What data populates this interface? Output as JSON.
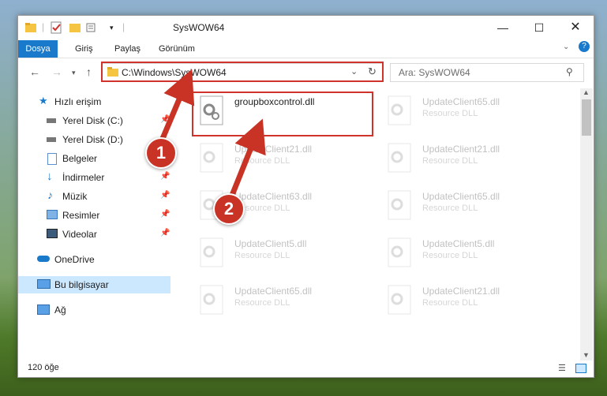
{
  "window": {
    "title": "SysWOW64"
  },
  "ribbon": {
    "tabs": [
      "Dosya",
      "Giriş",
      "Paylaş",
      "Görünüm"
    ]
  },
  "address": {
    "path": "C:\\Windows\\SysWOW64",
    "search_placeholder": "Ara: SysWOW64"
  },
  "sidebar": {
    "items": [
      {
        "label": "Hızlı erişim",
        "icon": "star-icon"
      },
      {
        "label": "Yerel Disk (C:)",
        "icon": "drive-icon"
      },
      {
        "label": "Yerel Disk (D:)",
        "icon": "drive-icon"
      },
      {
        "label": "Belgeler",
        "icon": "documents-icon"
      },
      {
        "label": "İndirmeler",
        "icon": "download-icon"
      },
      {
        "label": "Müzik",
        "icon": "music-icon"
      },
      {
        "label": "Resimler",
        "icon": "pictures-icon"
      },
      {
        "label": "Videolar",
        "icon": "videos-icon"
      },
      {
        "label": "OneDrive",
        "icon": "cloud-icon"
      },
      {
        "label": "Bu bilgisayar",
        "icon": "computer-icon"
      },
      {
        "label": "Ağ",
        "icon": "network-icon"
      }
    ]
  },
  "files": [
    {
      "name": "groupboxcontrol.dll",
      "type": ""
    },
    {
      "name": "UpdateClient65.dll",
      "type": "Resource DLL"
    },
    {
      "name": "UpdateClient21.dll",
      "type": "Resource DLL"
    },
    {
      "name": "UpdateClient21.dll",
      "type": "Resource DLL"
    },
    {
      "name": "UpdateClient63.dll",
      "type": "Resource DLL"
    },
    {
      "name": "UpdateClient65.dll",
      "type": "Resource DLL"
    },
    {
      "name": "UpdateClient5.dll",
      "type": "Resource DLL"
    },
    {
      "name": "UpdateClient5.dll",
      "type": "Resource DLL"
    },
    {
      "name": "UpdateClient65.dll",
      "type": "Resource DLL"
    },
    {
      "name": "UpdateClient21.dll",
      "type": "Resource DLL"
    }
  ],
  "status": {
    "count": "120 öğe"
  },
  "callouts": [
    "1",
    "2"
  ],
  "colors": {
    "accent": "#1979ca",
    "highlight": "#d0332c",
    "selection": "#cce8ff"
  }
}
